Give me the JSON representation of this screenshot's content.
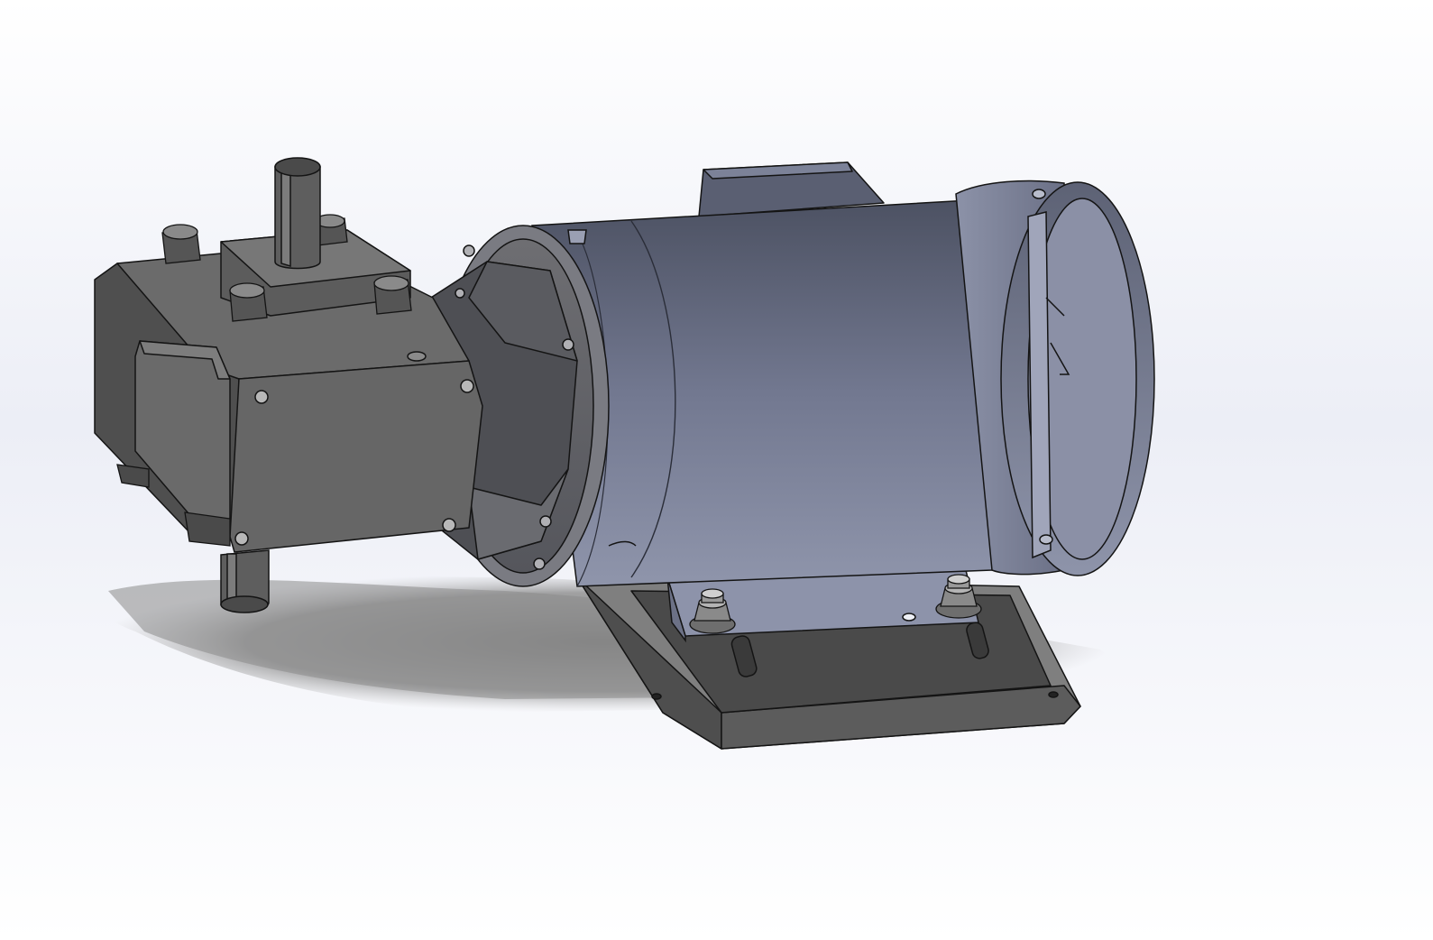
{
  "viewport": {
    "background_top": "#ffffff",
    "background_mid": "#eceef6",
    "background_bottom": "#ffffff"
  },
  "colors": {
    "motor_body": "#747a90",
    "motor_highlight": "#9aa0b6",
    "motor_shadow": "#565b6c",
    "gearbox": "#6e6e6e",
    "gearbox_light": "#8a8a8a",
    "gearbox_dark": "#505050",
    "base_plate": "#5a5a5a",
    "edge": "#141414",
    "ground_shadow": "#8e8e8e"
  },
  "model": {
    "components": [
      "motor-body",
      "motor-end-cap",
      "junction-box",
      "c-face-adapter",
      "gearbox-housing",
      "output-shaft-top",
      "output-shaft-bottom",
      "mounting-base-plate",
      "motor-foot",
      "hex-nut-left",
      "hex-nut-right"
    ]
  }
}
